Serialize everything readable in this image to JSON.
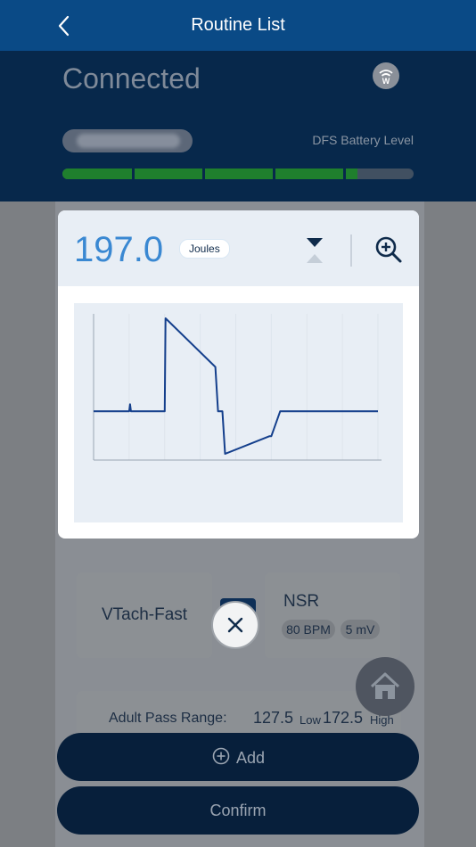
{
  "header": {
    "title": "Routine List"
  },
  "connection": {
    "status": "Connected",
    "battery_label": "DFS Battery Level",
    "battery_level": 0.84
  },
  "popup": {
    "energy_value": "197.0",
    "energy_unit": "Joules",
    "waveform": {
      "type": "line",
      "points": [
        [
          0,
          0
        ],
        [
          40,
          0
        ],
        [
          41,
          0.08
        ],
        [
          42,
          0
        ],
        [
          80,
          0
        ],
        [
          81,
          1.05
        ],
        [
          135,
          0.52
        ],
        [
          137,
          0.5
        ],
        [
          140,
          0
        ],
        [
          145,
          0
        ],
        [
          148,
          -0.48
        ],
        [
          198,
          -0.28
        ],
        [
          200,
          -0.28
        ],
        [
          210,
          0
        ],
        [
          320,
          0
        ]
      ]
    }
  },
  "routine": {
    "arrhythmia": "VTach-Fast",
    "rhythm": {
      "name": "NSR",
      "bpm": "80 BPM",
      "amplitude": "5 mV"
    },
    "pass_range": {
      "label": "Adult Pass Range:",
      "low_value": "127.5",
      "low_label": "Low",
      "high_value": "172.5",
      "high_label": "High"
    }
  },
  "buttons": {
    "add": "Add",
    "confirm": "Confirm"
  }
}
